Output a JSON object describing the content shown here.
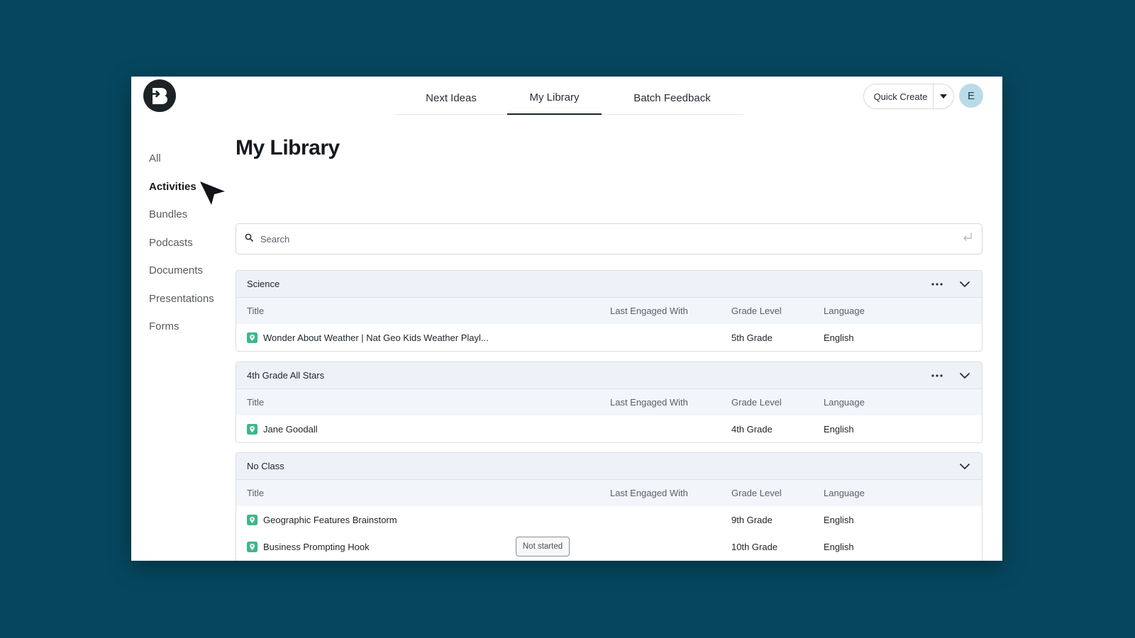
{
  "colors": {
    "background": "#06475f",
    "accent": "#1c2226",
    "activity_icon": "#3cb88a",
    "avatar_bg": "#b9dbe8"
  },
  "header": {
    "logo_icon": "brand-b-logo",
    "tabs": [
      {
        "label": "Next Ideas",
        "active": false
      },
      {
        "label": "My Library",
        "active": true
      },
      {
        "label": "Batch Feedback",
        "active": false
      }
    ],
    "quick_create_label": "Quick Create",
    "avatar_initial": "E"
  },
  "sidebar": {
    "items": [
      {
        "label": "All",
        "active": false
      },
      {
        "label": "Activities",
        "active": true
      },
      {
        "label": "Bundles",
        "active": false
      },
      {
        "label": "Podcasts",
        "active": false
      },
      {
        "label": "Documents",
        "active": false
      },
      {
        "label": "Presentations",
        "active": false
      },
      {
        "label": "Forms",
        "active": false
      }
    ]
  },
  "main": {
    "title": "My Library",
    "search": {
      "placeholder": "Search",
      "value": ""
    },
    "columns": {
      "title": "Title",
      "last_engaged": "Last Engaged With",
      "grade": "Grade Level",
      "language": "Language"
    },
    "groups": [
      {
        "name": "Science",
        "rows": [
          {
            "title": "Wonder About Weather | Nat Geo Kids Weather Playl...",
            "status": "",
            "grade": "5th Grade",
            "language": "English"
          }
        ]
      },
      {
        "name": "4th Grade All Stars",
        "rows": [
          {
            "title": "Jane Goodall",
            "status": "",
            "grade": "4th Grade",
            "language": "English"
          }
        ]
      },
      {
        "name": "No Class",
        "rows": [
          {
            "title": "Geographic Features Brainstorm",
            "status": "",
            "grade": "9th Grade",
            "language": "English"
          },
          {
            "title": "Business Prompting Hook",
            "status": "Not started",
            "grade": "10th Grade",
            "language": "English"
          }
        ]
      }
    ]
  }
}
